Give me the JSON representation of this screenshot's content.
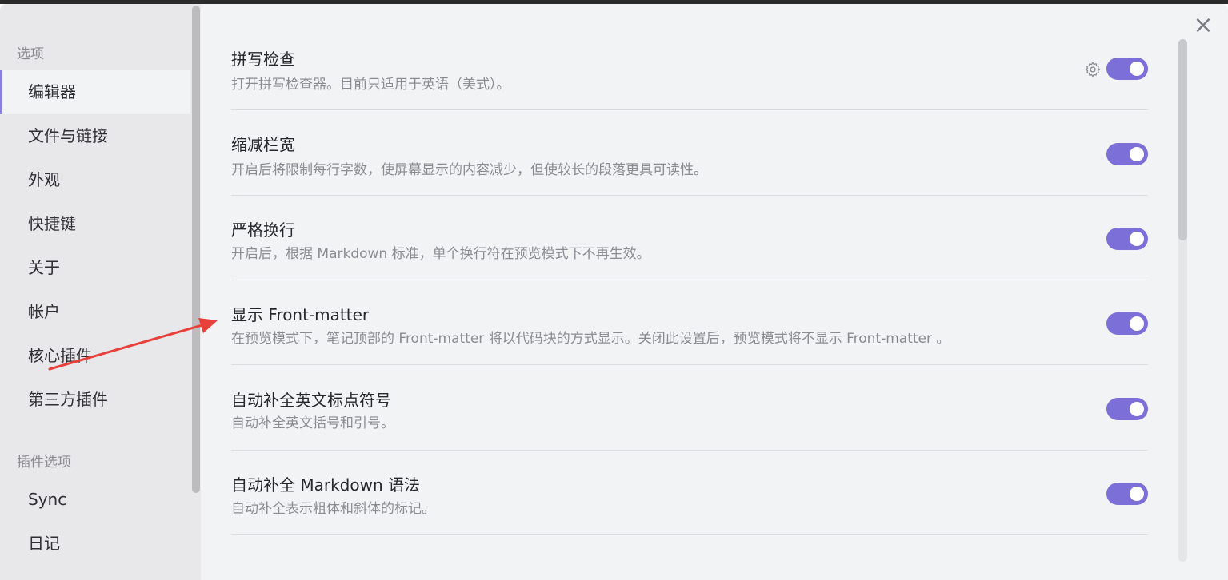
{
  "window": {
    "close_icon": "close-icon"
  },
  "sidebar": {
    "section_options": "选项",
    "items": [
      {
        "label": "编辑器",
        "active": true
      },
      {
        "label": "文件与链接"
      },
      {
        "label": "外观"
      },
      {
        "label": "快捷键"
      },
      {
        "label": "关于"
      },
      {
        "label": "帐户"
      },
      {
        "label": "核心插件"
      },
      {
        "label": "第三方插件"
      }
    ],
    "section_plugin_options": "插件选项",
    "plugin_items": [
      {
        "label": "Sync"
      },
      {
        "label": "日记"
      }
    ]
  },
  "settings": [
    {
      "name": "拼写检查",
      "desc": "打开拼写检查器。目前只适用于英语（美式）。",
      "enabled": true,
      "has_gear": true
    },
    {
      "name": "缩减栏宽",
      "desc": "开启后将限制每行字数，使屏幕显示的内容减少，但使较长的段落更具可读性。",
      "enabled": true
    },
    {
      "name": "严格换行",
      "desc": "开启后，根据 Markdown 标准，单个换行符在预览模式下不再生效。",
      "enabled": true
    },
    {
      "name": "显示 Front-matter",
      "desc": "在预览模式下，笔记顶部的 Front-matter 将以代码块的方式显示。关闭此设置后，预览模式将不显示 Front-matter 。",
      "enabled": true
    },
    {
      "name": "自动补全英文标点符号",
      "desc": "自动补全英文括号和引号。",
      "enabled": true
    },
    {
      "name": "自动补全 Markdown 语法",
      "desc": "自动补全表示粗体和斜体的标记。",
      "enabled": true
    }
  ],
  "colors": {
    "accent": "#7c6fd8",
    "annotation_arrow": "#e8403a"
  }
}
